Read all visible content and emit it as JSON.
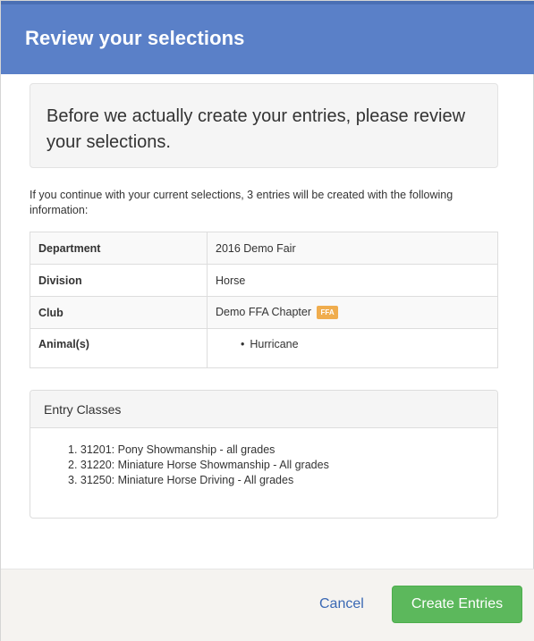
{
  "header": {
    "title": "Review your selections"
  },
  "intro": {
    "message": "Before we actually create your entries, please review your selections."
  },
  "summary": {
    "text": "If you continue with your current selections, 3 entries will be created with the following information:"
  },
  "details": [
    {
      "label": "Department",
      "value": "2016 Demo Fair"
    },
    {
      "label": "Division",
      "value": "Horse"
    },
    {
      "label": "Club",
      "value": "Demo FFA Chapter",
      "badge": "FFA"
    },
    {
      "label": "Animal(s)",
      "animals": [
        "Hurricane"
      ]
    }
  ],
  "entry_classes": {
    "heading": "Entry Classes",
    "items": [
      "1. 31201: Pony Showmanship - all grades",
      "2. 31220: Miniature Horse Showmanship - All grades",
      "3. 31250: Miniature Horse Driving - All grades"
    ]
  },
  "footer": {
    "cancel_label": "Cancel",
    "create_label": "Create Entries"
  },
  "colors": {
    "header_bg": "#5a80c8",
    "primary_action": "#5cb85c",
    "link": "#3a68b4",
    "badge": "#f0ad4e"
  }
}
